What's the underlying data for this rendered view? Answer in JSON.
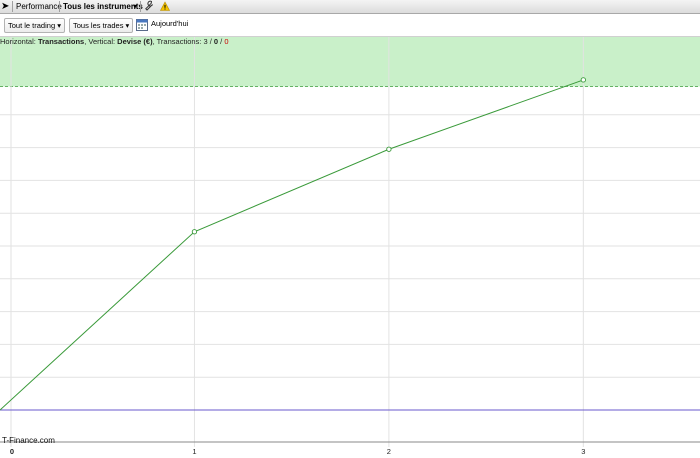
{
  "topbar": {
    "tab_performance": "Performance",
    "tab_instruments": "Tous les instruments",
    "dropdown_arrow": "▾",
    "tools_icon": "wrench-icon",
    "warning_icon": "warning-icon"
  },
  "toolbar": {
    "trading_filter": "Tout le trading",
    "trades_filter": "Tous les trades",
    "dropdown_arrow": "▾",
    "calendar_icon": "calendar-icon",
    "date_label": "Aujourd'hui"
  },
  "info": {
    "horizontal_label": "Horizontal: ",
    "horizontal_value": "Transactions",
    "vertical_label": ", Vertical: ",
    "vertical_value": "Devise (€)",
    "transactions_label": ", Transactions: ",
    "count_total": "3",
    "slash1": " / ",
    "count_mid": "0",
    "slash2": " / ",
    "count_red": "0"
  },
  "watermark": "T-Finance.com",
  "colors": {
    "line": "#3a9a3a",
    "band": "#c9f0c9",
    "baseline": "#6a5acd",
    "grid": "#e2e2e2",
    "red": "#cc0000"
  },
  "chart_data": {
    "type": "line",
    "title": "",
    "xlabel": "",
    "ylabel": "",
    "x": [
      0,
      1,
      2,
      3
    ],
    "y": [
      0,
      0.54,
      0.79,
      1.0
    ],
    "x_ticks": [
      "0",
      "1",
      "2",
      "3"
    ],
    "xlim": [
      0,
      3.6
    ],
    "ylim": [
      0,
      1.13
    ],
    "band_above": 0.98,
    "grid": true
  }
}
